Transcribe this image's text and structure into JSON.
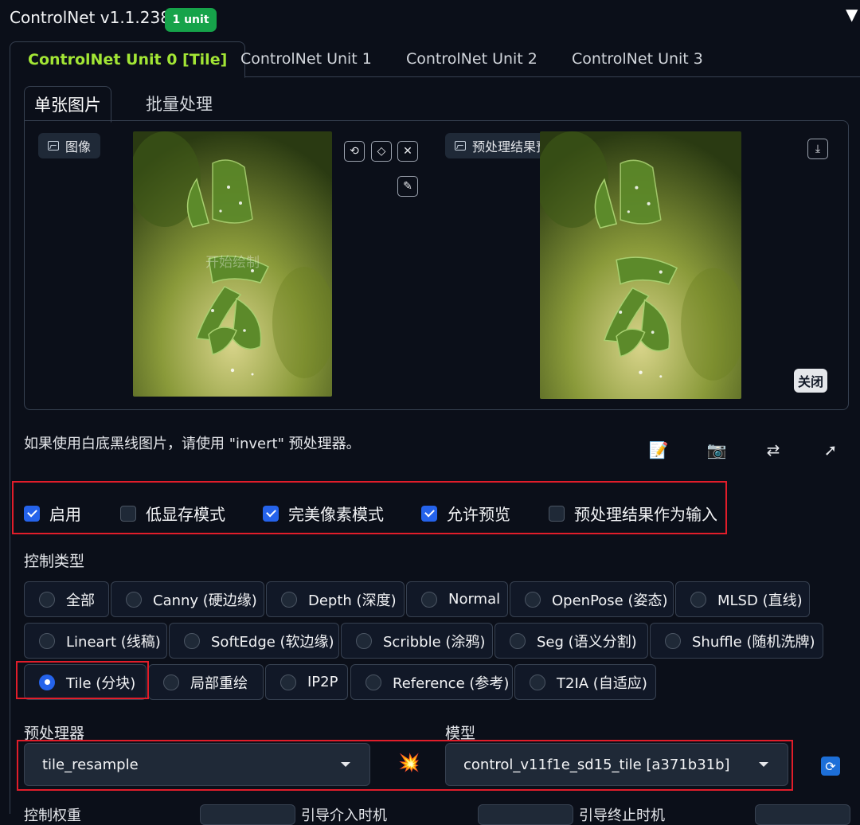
{
  "header": {
    "title": "ControlNet v1.1.238",
    "badge": "1 unit"
  },
  "unit_tabs": [
    "ControlNet Unit 0 [Tile]",
    "ControlNet Unit 1",
    "ControlNet Unit 2",
    "ControlNet Unit 3"
  ],
  "image_tabs": [
    "单张图片",
    "批量处理"
  ],
  "input_panel": {
    "label": "图像",
    "overlay_text": "开始绘制",
    "icons": [
      "rotate-icon",
      "eraser-icon",
      "close-icon",
      "brush-icon"
    ]
  },
  "preview_panel": {
    "label": "预处理结果预览",
    "close_label": "关闭"
  },
  "hint": "如果使用白底黑线图片，请使用 \"invert\" 预处理器。",
  "actions": [
    "edit-icon",
    "camera-icon",
    "swap-icon",
    "send-icon"
  ],
  "options": [
    {
      "label": "启用",
      "checked": true
    },
    {
      "label": "低显存模式",
      "checked": false
    },
    {
      "label": "完美像素模式",
      "checked": true
    },
    {
      "label": "允许预览",
      "checked": true
    },
    {
      "label": "预处理结果作为输入",
      "checked": false
    }
  ],
  "control_type": {
    "label": "控制类型",
    "selected": "Tile (分块)",
    "rows": [
      [
        "全部",
        "Canny (硬边缘)",
        "Depth (深度)",
        "Normal",
        "OpenPose (姿态)",
        "MLSD (直线)"
      ],
      [
        "Lineart (线稿)",
        "SoftEdge (软边缘)",
        "Scribble (涂鸦)",
        "Seg (语义分割)",
        "Shuffle (随机洗牌)"
      ],
      [
        "Tile (分块)",
        "局部重绘",
        "IP2P",
        "Reference (参考)",
        "T2IA (自适应)"
      ]
    ]
  },
  "preprocessor": {
    "label": "预处理器",
    "value": "tile_resample"
  },
  "model": {
    "label": "模型",
    "value": "control_v11f1e_sd15_tile [a371b31b]"
  },
  "bottom_labels": [
    "控制权重",
    "引导介入时机",
    "引导终止时机"
  ],
  "colors": {
    "accent": "#a3e635",
    "badge": "#16a34a",
    "checkbox": "#2563eb",
    "highlight": "#e11d2a"
  }
}
